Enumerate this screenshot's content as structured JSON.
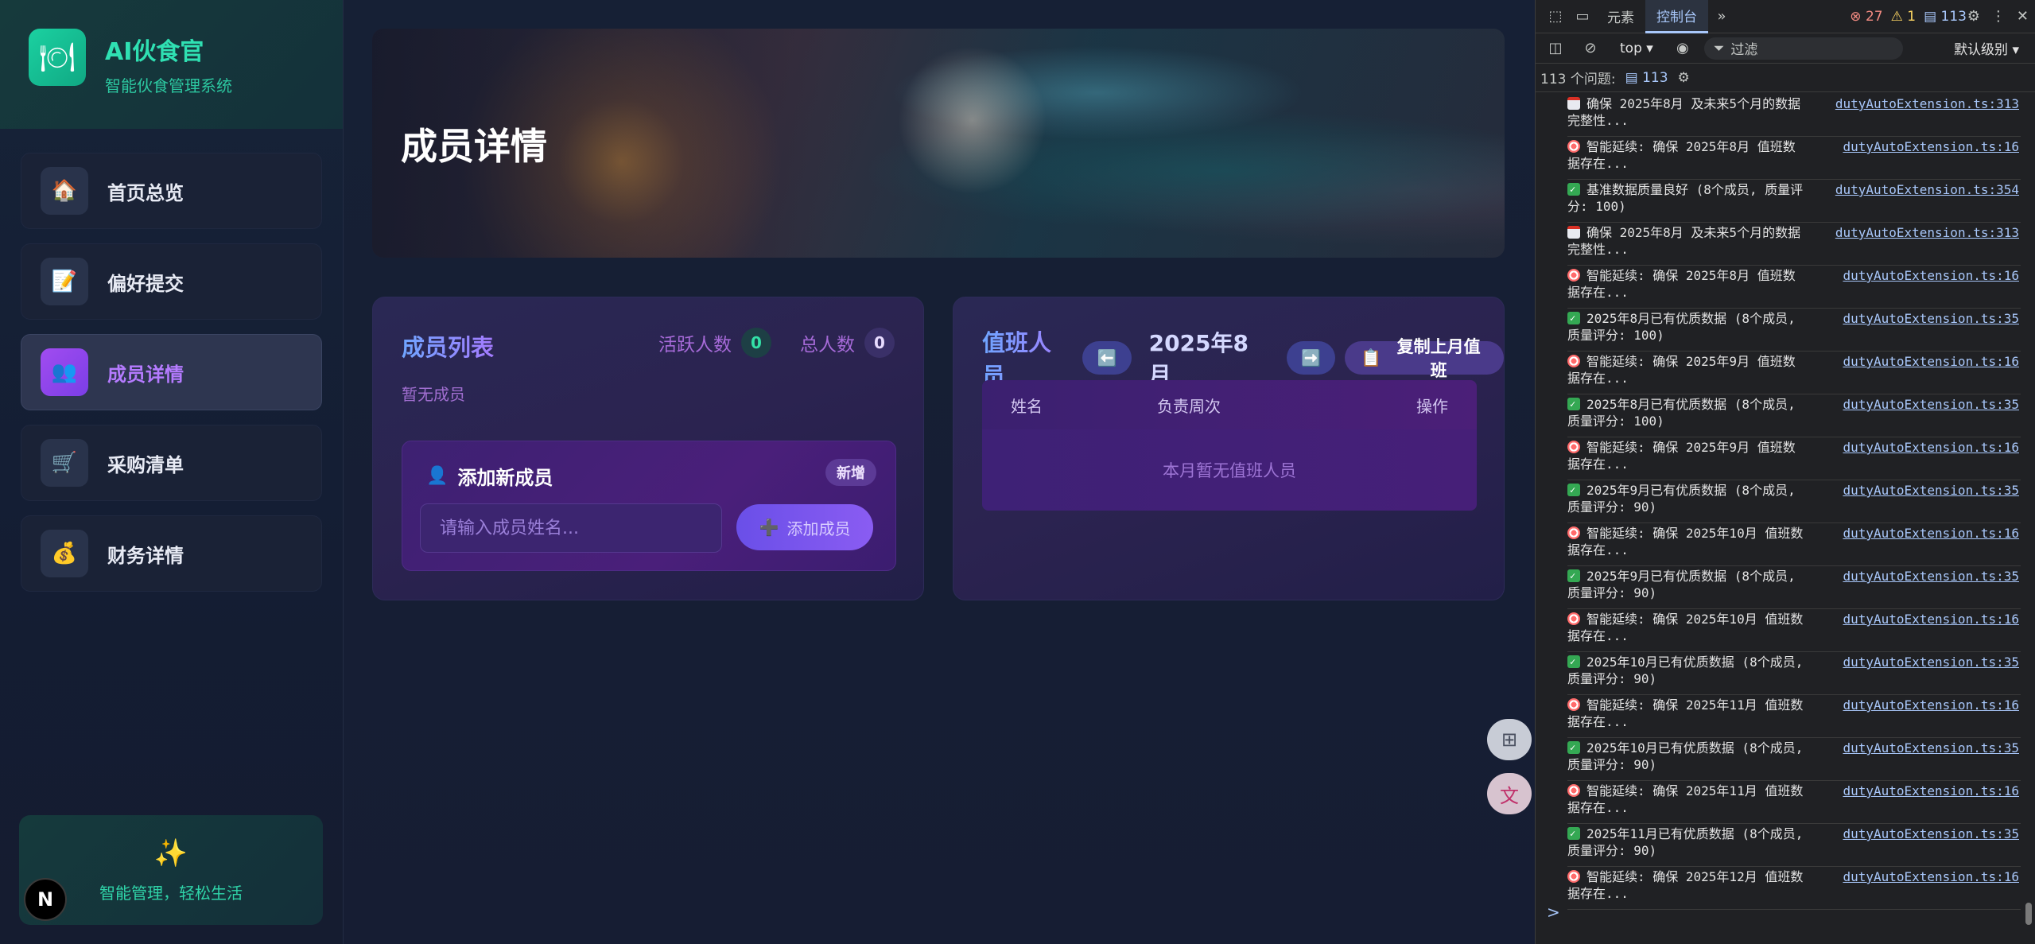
{
  "brand": {
    "logo_icon": "plate-icon",
    "title": "AI伙食官",
    "subtitle": "智能伙食管理系统"
  },
  "sidebar": {
    "items": [
      {
        "icon": "🏠",
        "label": "首页总览",
        "active": false
      },
      {
        "icon": "📝",
        "label": "偏好提交",
        "active": false
      },
      {
        "icon": "👥",
        "label": "成员详情",
        "active": true
      },
      {
        "icon": "🛒",
        "label": "采购清单",
        "active": false
      },
      {
        "icon": "💰",
        "label": "财务详情",
        "active": false
      }
    ],
    "footer": {
      "icon": "✨",
      "text": "智能管理，轻松生活"
    },
    "next_badge": "N"
  },
  "hero": {
    "title": "成员详情"
  },
  "members": {
    "title": "成员列表",
    "active_label": "活跃人数",
    "active_count": "0",
    "total_label": "总人数",
    "total_count": "0",
    "empty_text": "暂无成员",
    "add": {
      "icon": "👤",
      "title": "添加新成员",
      "badge": "新增",
      "placeholder": "请输入成员姓名...",
      "button_icon": "➕",
      "button_label": "添加成员"
    }
  },
  "duty": {
    "title": "值班人员",
    "prev_icon": "⬅️",
    "month": "2025年8月",
    "next_icon": "➡️",
    "copy_icon": "📋",
    "copy_label": "复制上月值班",
    "columns": [
      "姓名",
      "负责周次",
      "操作"
    ],
    "empty_text": "本月暂无值班人员"
  },
  "devtools": {
    "tabs": [
      "元素",
      "控制台"
    ],
    "active_tab": "控制台",
    "errors": "27",
    "warnings": "1",
    "infos": "113",
    "context": "top",
    "filter_placeholder": "过滤",
    "level": "默认级别",
    "issues_label": "113 个问题:",
    "issues_count": "113",
    "prompt": ">",
    "logs": [
      {
        "icon": "cal",
        "text": "确保 2025年8月 及未来5个月的数据完整性...",
        "src": "dutyAutoExtension.ts:313"
      },
      {
        "icon": "target",
        "text": "智能延续: 确保 2025年8月 值班数据存在...",
        "src": "dutyAutoExtension.ts:16"
      },
      {
        "icon": "check",
        "text": "基准数据质量良好 (8个成员, 质量评分: 100)",
        "src": "dutyAutoExtension.ts:354"
      },
      {
        "icon": "cal",
        "text": "确保 2025年8月 及未来5个月的数据完整性...",
        "src": "dutyAutoExtension.ts:313"
      },
      {
        "icon": "target",
        "text": "智能延续: 确保 2025年8月 值班数据存在...",
        "src": "dutyAutoExtension.ts:16"
      },
      {
        "icon": "check",
        "text": "2025年8月已有优质数据 (8个成员, 质量评分: 100)",
        "src": "dutyAutoExtension.ts:35"
      },
      {
        "icon": "target",
        "text": "智能延续: 确保 2025年9月 值班数据存在...",
        "src": "dutyAutoExtension.ts:16"
      },
      {
        "icon": "check",
        "text": "2025年8月已有优质数据 (8个成员, 质量评分: 100)",
        "src": "dutyAutoExtension.ts:35"
      },
      {
        "icon": "target",
        "text": "智能延续: 确保 2025年9月 值班数据存在...",
        "src": "dutyAutoExtension.ts:16"
      },
      {
        "icon": "check",
        "text": "2025年9月已有优质数据 (8个成员, 质量评分: 90)",
        "src": "dutyAutoExtension.ts:35"
      },
      {
        "icon": "target",
        "text": "智能延续: 确保 2025年10月 值班数据存在...",
        "src": "dutyAutoExtension.ts:16"
      },
      {
        "icon": "check",
        "text": "2025年9月已有优质数据 (8个成员, 质量评分: 90)",
        "src": "dutyAutoExtension.ts:35"
      },
      {
        "icon": "target",
        "text": "智能延续: 确保 2025年10月 值班数据存在...",
        "src": "dutyAutoExtension.ts:16"
      },
      {
        "icon": "check",
        "text": "2025年10月已有优质数据 (8个成员, 质量评分: 90)",
        "src": "dutyAutoExtension.ts:35"
      },
      {
        "icon": "target",
        "text": "智能延续: 确保 2025年11月 值班数据存在...",
        "src": "dutyAutoExtension.ts:16"
      },
      {
        "icon": "check",
        "text": "2025年10月已有优质数据 (8个成员, 质量评分: 90)",
        "src": "dutyAutoExtension.ts:35"
      },
      {
        "icon": "target",
        "text": "智能延续: 确保 2025年11月 值班数据存在...",
        "src": "dutyAutoExtension.ts:16"
      },
      {
        "icon": "check",
        "text": "2025年11月已有优质数据 (8个成员, 质量评分: 90)",
        "src": "dutyAutoExtension.ts:35"
      },
      {
        "icon": "target",
        "text": "智能延续: 确保 2025年12月 值班数据存在...",
        "src": "dutyAutoExtension.ts:16"
      }
    ]
  },
  "colors": {
    "accent_green": "#2fe0b2",
    "accent_purple": "#a47bff",
    "active_nav": "#b57bff"
  }
}
